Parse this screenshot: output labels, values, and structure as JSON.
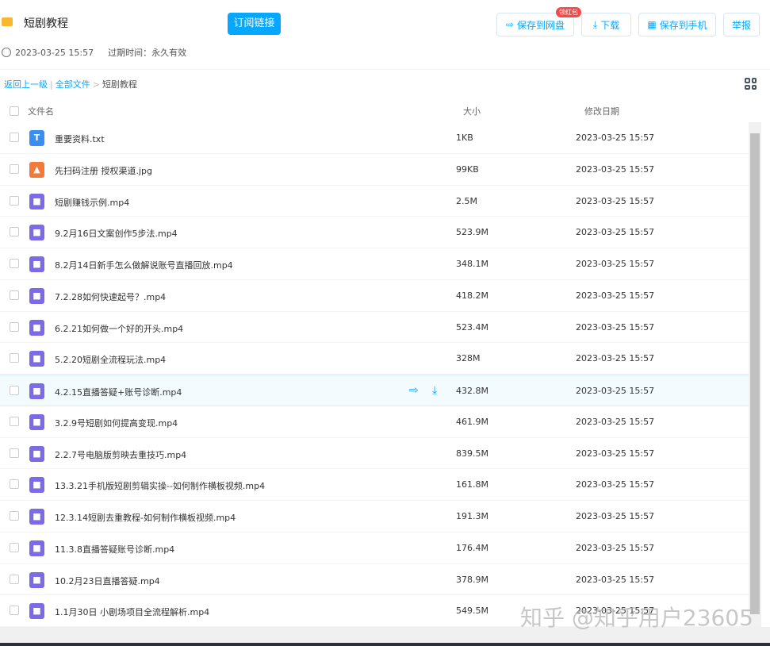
{
  "header": {
    "title": "短剧教程",
    "subscribe_label": "订阅链接",
    "time": "2023-03-25 15:57",
    "expire": "过期时间：永久有效"
  },
  "toolbar": {
    "save_disk": "保存到网盘",
    "badge": "领红包",
    "download": "下载",
    "save_phone": "保存到手机",
    "report": "举报"
  },
  "breadcrumb": {
    "back": "返回上一级",
    "all": "全部文件",
    "sep": ">",
    "current": "短剧教程"
  },
  "columns": {
    "name": "文件名",
    "size": "大小",
    "date": "修改日期"
  },
  "files": [
    {
      "name": "重要资料.txt",
      "size": "1KB",
      "date": "2023-03-25 15:57",
      "type": "txt"
    },
    {
      "name": "先扫码注册 授权渠道.jpg",
      "size": "99KB",
      "date": "2023-03-25 15:57",
      "type": "img"
    },
    {
      "name": "短剧赚钱示例.mp4",
      "size": "2.5M",
      "date": "2023-03-25 15:57",
      "type": "video"
    },
    {
      "name": "9.2月16日文案创作5步法.mp4",
      "size": "523.9M",
      "date": "2023-03-25 15:57",
      "type": "video"
    },
    {
      "name": "8.2月14日新手怎么做解说账号直播回放.mp4",
      "size": "348.1M",
      "date": "2023-03-25 15:57",
      "type": "video"
    },
    {
      "name": "7.2.28如何快速起号？.mp4",
      "size": "418.2M",
      "date": "2023-03-25 15:57",
      "type": "video"
    },
    {
      "name": "6.2.21如何做一个好的开头.mp4",
      "size": "523.4M",
      "date": "2023-03-25 15:57",
      "type": "video"
    },
    {
      "name": "5.2.20短剧全流程玩法.mp4",
      "size": "328M",
      "date": "2023-03-25 15:57",
      "type": "video"
    },
    {
      "name": "4.2.15直播答疑+账号诊断.mp4",
      "size": "432.8M",
      "date": "2023-03-25 15:57",
      "type": "video"
    },
    {
      "name": "3.2.9号短剧如何提高变现.mp4",
      "size": "461.9M",
      "date": "2023-03-25 15:57",
      "type": "video"
    },
    {
      "name": "2.2.7号电脑版剪映去重技巧.mp4",
      "size": "839.5M",
      "date": "2023-03-25 15:57",
      "type": "video"
    },
    {
      "name": "13.3.21手机版短剧剪辑实操--如何制作横板视频.mp4",
      "size": "161.8M",
      "date": "2023-03-25 15:57",
      "type": "video"
    },
    {
      "name": "12.3.14短剧去重教程-如何制作横板视频.mp4",
      "size": "191.3M",
      "date": "2023-03-25 15:57",
      "type": "video"
    },
    {
      "name": "11.3.8直播答疑账号诊断.mp4",
      "size": "176.4M",
      "date": "2023-03-25 15:57",
      "type": "video"
    },
    {
      "name": "10.2月23日直播答疑.mp4",
      "size": "378.9M",
      "date": "2023-03-25 15:57",
      "type": "video"
    },
    {
      "name": "1.1月30日 小剧场项目全流程解析.mp4",
      "size": "549.5M",
      "date": "2023-03-25 15:57",
      "type": "video"
    }
  ],
  "watermark": "知乎 @知乎用户23605",
  "colors": {
    "accent": "#06a7ff",
    "video": "#7b6be6",
    "txt": "#3a8ef0",
    "img": "#f27b3c",
    "badge": "#f04a4a"
  }
}
